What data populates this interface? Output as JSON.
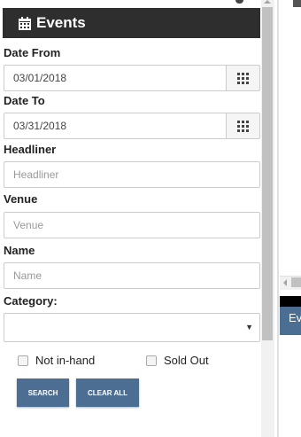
{
  "panel": {
    "title": "Events",
    "title_icon": "calendar-icon",
    "date_from": {
      "label": "Date From",
      "value": "03/01/2018",
      "picker_icon": "grid-icon"
    },
    "date_to": {
      "label": "Date To",
      "value": "03/31/2018",
      "picker_icon": "grid-icon"
    },
    "headliner": {
      "label": "Headliner",
      "placeholder": "Headliner",
      "value": ""
    },
    "venue": {
      "label": "Venue",
      "placeholder": "Venue",
      "value": ""
    },
    "name": {
      "label": "Name",
      "placeholder": "Name",
      "value": ""
    },
    "category": {
      "label": "Category:",
      "value": ""
    },
    "checkboxes": {
      "not_in_hand": {
        "label": "Not in-hand",
        "checked": false
      },
      "sold_out": {
        "label": "Sold Out",
        "checked": false
      }
    },
    "buttons": {
      "search": "SEARCH",
      "clear_all": "CLEAR ALL"
    }
  },
  "right_pane": {
    "tab_label": "Ev"
  },
  "colors": {
    "header_bg": "#2e2e2e",
    "button_bg": "#4d6e93"
  }
}
